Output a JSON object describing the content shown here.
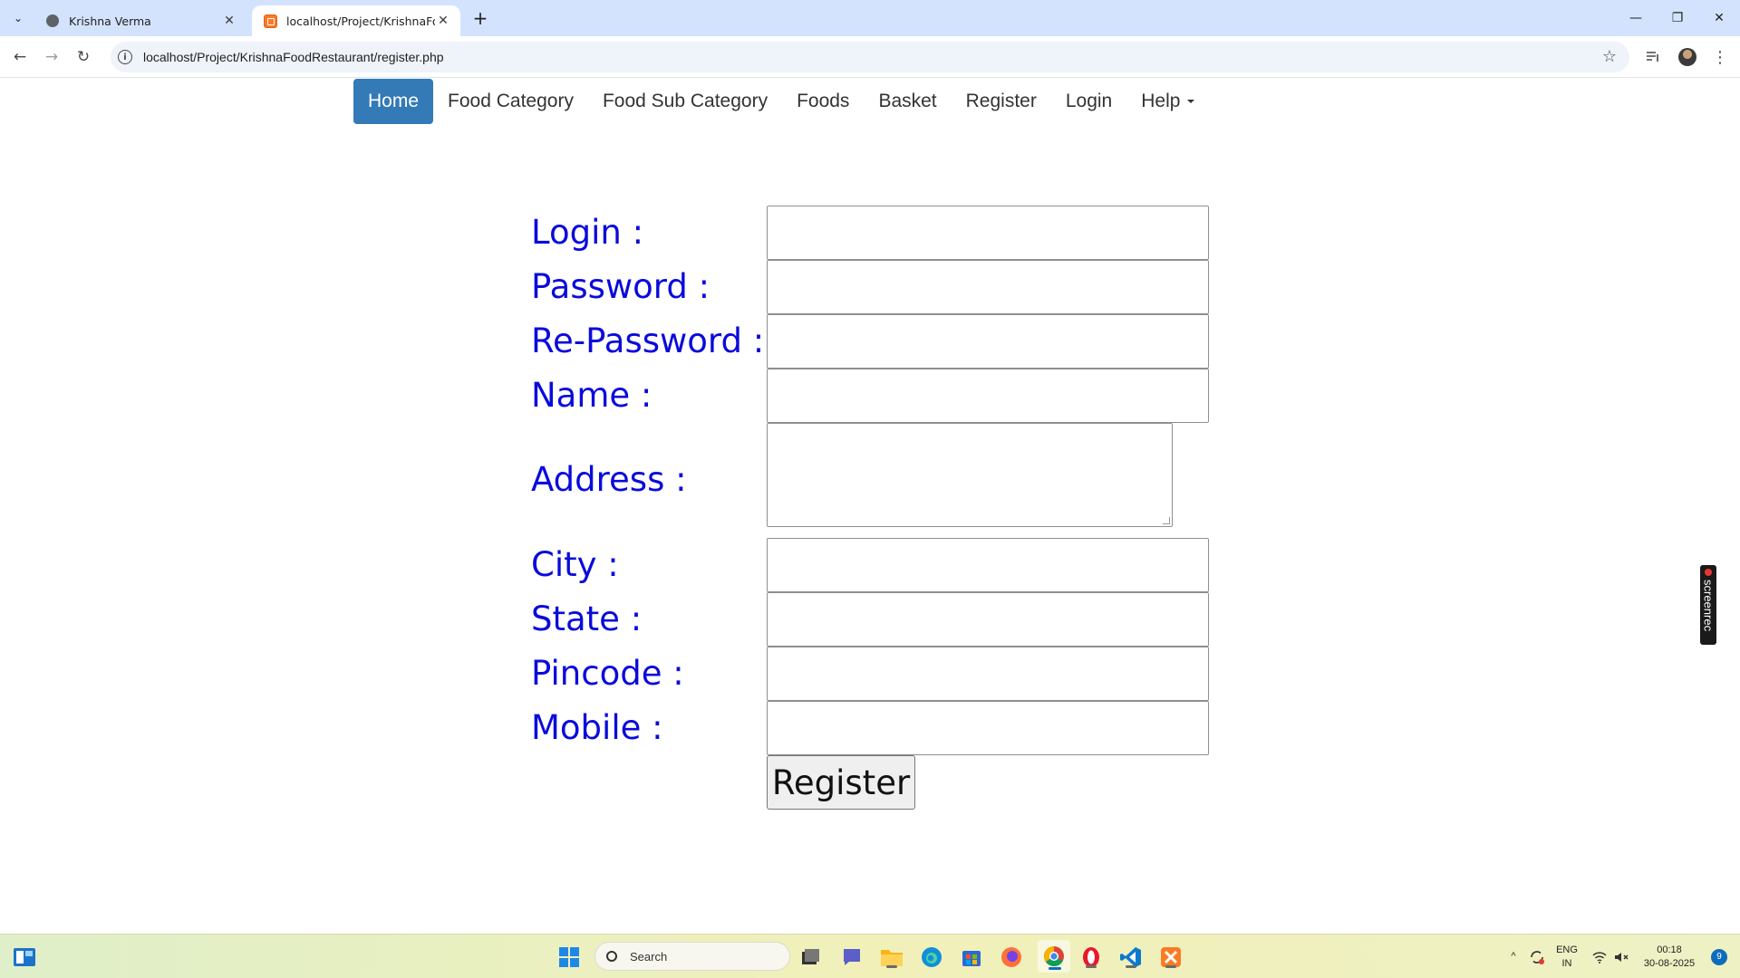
{
  "browser": {
    "tabs": [
      {
        "title": "Krishna Verma",
        "icon": "globe-icon",
        "active": false
      },
      {
        "title": "localhost/Project/KrishnaFoodR",
        "icon": "xampp-icon",
        "active": true
      }
    ],
    "url": "localhost/Project/KrishnaFoodRestaurant/register.php"
  },
  "nav": {
    "items": [
      "Home",
      "Food Category",
      "Food Sub Category",
      "Foods",
      "Basket",
      "Register",
      "Login"
    ],
    "help": "Help",
    "active": "Home"
  },
  "form": {
    "fields": [
      {
        "label": "Login :",
        "type": "text",
        "value": ""
      },
      {
        "label": "Password :",
        "type": "password",
        "value": ""
      },
      {
        "label": "Re-Password :",
        "type": "password",
        "value": ""
      },
      {
        "label": "Name :",
        "type": "text",
        "value": ""
      },
      {
        "label": "Address :",
        "type": "textarea",
        "value": ""
      },
      {
        "label": "City :",
        "type": "text",
        "value": ""
      },
      {
        "label": "State :",
        "type": "text",
        "value": ""
      },
      {
        "label": "Pincode :",
        "type": "text",
        "value": ""
      },
      {
        "label": "Mobile :",
        "type": "text",
        "value": ""
      }
    ],
    "submit_label": "Register"
  },
  "overlay": {
    "screenrec_label": "screenrec"
  },
  "taskbar": {
    "search_placeholder": "Search",
    "lang_line1": "ENG",
    "lang_line2": "IN",
    "time": "00:18",
    "date": "30-08-2025",
    "notifications": "9"
  },
  "colors": {
    "accent": "#337ab7",
    "label": "#0a0adc",
    "tabstrip": "#d3e3fd"
  }
}
